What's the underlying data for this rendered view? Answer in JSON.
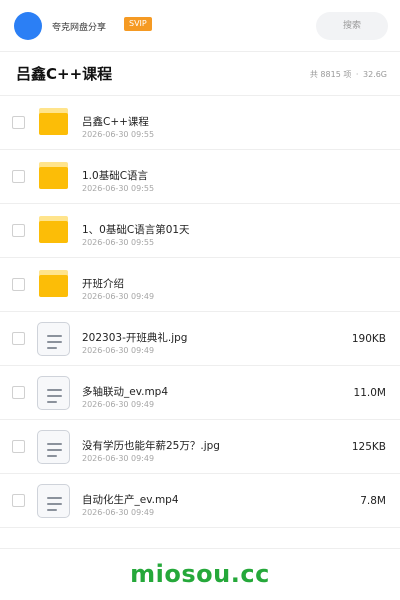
{
  "header": {
    "share_name": "夸克网盘分享",
    "badge": "SVIP",
    "search_placeholder": "搜索"
  },
  "folder": {
    "title": "吕鑫C++课程",
    "count_text": "共 8815 项",
    "separator": "·",
    "total_size": "32.6G"
  },
  "files": [
    {
      "name": "吕鑫C++课程",
      "date": "2026-06-30 09:55",
      "size": "",
      "type": "folder",
      "icon": "folder-icon"
    },
    {
      "name": "1.0基础C语言",
      "date": "2026-06-30 09:55",
      "size": "",
      "type": "folder",
      "icon": "folder-icon"
    },
    {
      "name": "1、0基础C语言第01天",
      "date": "2026-06-30 09:55",
      "size": "",
      "type": "folder",
      "icon": "folder-icon"
    },
    {
      "name": "开班介绍",
      "date": "2026-06-30 09:49",
      "size": "",
      "type": "folder",
      "icon": "folder-icon"
    },
    {
      "name": "202303-开班典礼.jpg",
      "date": "2026-06-30 09:49",
      "size": "190KB",
      "type": "file",
      "icon": "file-icon"
    },
    {
      "name": "多轴联动_ev.mp4",
      "date": "2026-06-30 09:49",
      "size": "11.0M",
      "type": "file",
      "icon": "file-icon"
    },
    {
      "name": "没有学历也能年薪25万？.jpg",
      "date": "2026-06-30 09:49",
      "size": "125KB",
      "type": "file",
      "icon": "file-icon"
    },
    {
      "name": "自动化生产_ev.mp4",
      "date": "2026-06-30 09:49",
      "size": "7.8M",
      "type": "file",
      "icon": "file-icon"
    }
  ],
  "watermark": "miosou.cc",
  "colors": {
    "avatar": "#2b7ff5",
    "svip_badge": "#f59a23",
    "folder": "#fcbd07",
    "watermark": "#25a83a"
  }
}
